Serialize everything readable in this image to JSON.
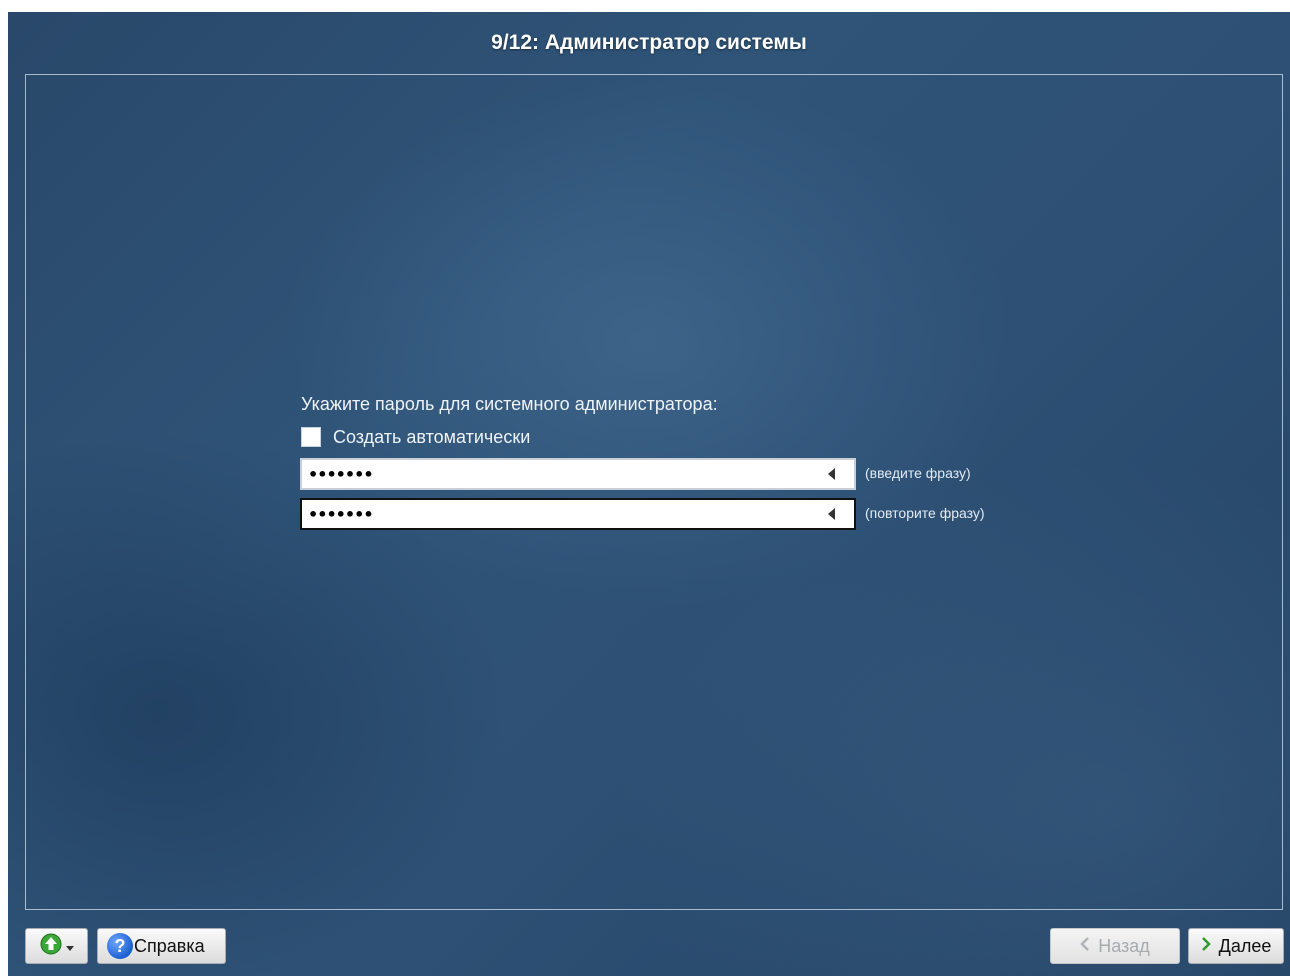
{
  "window": {
    "title": "9/12: Администратор системы"
  },
  "form": {
    "prompt": "Укажите пароль для системного администратора:",
    "auto_checkbox_label": "Создать автоматически",
    "auto_checked": false,
    "password_value": "•••••••",
    "password_hint": "(введите фразу)",
    "confirm_value": "•••••••",
    "confirm_hint": "(повторите фразу)"
  },
  "footer": {
    "help_label": "Справка",
    "back_label": "Назад",
    "next_label": "Далее"
  },
  "icons": {
    "menu": "green-up-arrow-icon",
    "help": "help-icon",
    "back": "chevron-left-icon",
    "next": "chevron-right-icon",
    "field_action": "backspace-triangle-icon"
  },
  "colors": {
    "background": "#2d5074",
    "accent_green": "#3aa836",
    "help_blue": "#1b5fd0"
  }
}
